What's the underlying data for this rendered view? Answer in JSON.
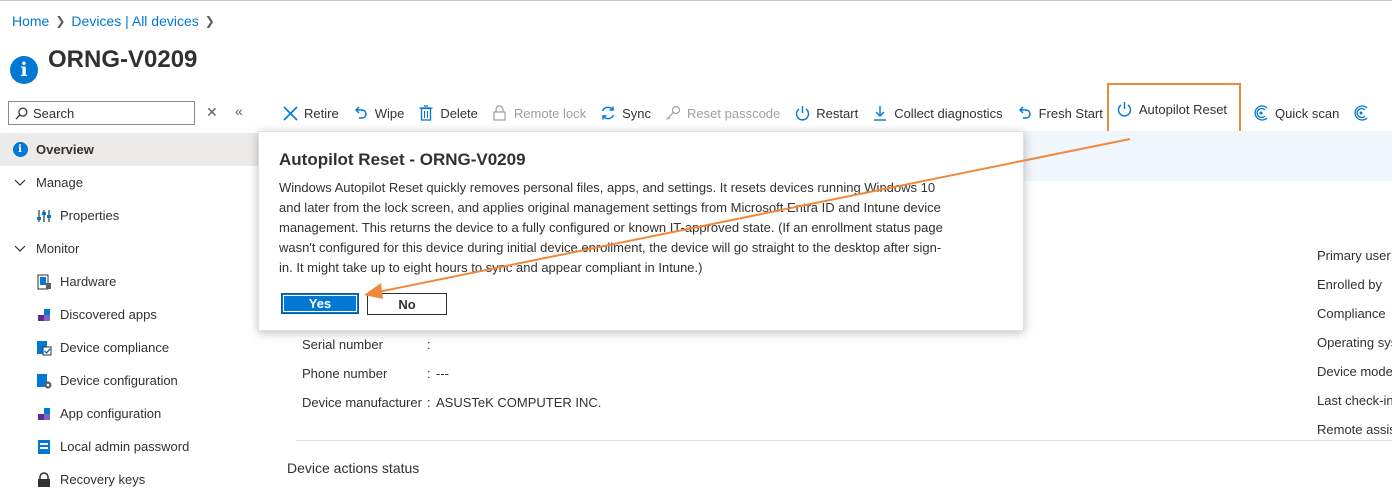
{
  "breadcrumb": {
    "home": "Home",
    "devices": "Devices | All devices"
  },
  "page": {
    "title": "ORNG-V0209"
  },
  "search": {
    "placeholder": "Search"
  },
  "sidebar": {
    "items": [
      {
        "label": "Overview",
        "icon": "info-icon",
        "active": true
      },
      {
        "label": "Manage",
        "icon": "chevron-down-icon"
      },
      {
        "label": "Properties",
        "icon": "sliders-icon"
      },
      {
        "label": "Monitor",
        "icon": "chevron-down-icon"
      },
      {
        "label": "Hardware",
        "icon": "hardware-icon"
      },
      {
        "label": "Discovered apps",
        "icon": "apps-icon"
      },
      {
        "label": "Device compliance",
        "icon": "compliance-icon"
      },
      {
        "label": "Device configuration",
        "icon": "configuration-icon"
      },
      {
        "label": "App configuration",
        "icon": "app-config-icon"
      },
      {
        "label": "Local admin password",
        "icon": "password-icon"
      },
      {
        "label": "Recovery keys",
        "icon": "key-icon"
      }
    ]
  },
  "toolbar": {
    "retire": "Retire",
    "wipe": "Wipe",
    "delete": "Delete",
    "remote_lock": "Remote lock",
    "sync": "Sync",
    "reset_passcode": "Reset passcode",
    "restart": "Restart",
    "collect_diagnostics": "Collect diagnostics",
    "fresh_start": "Fresh Start",
    "autopilot_reset": "Autopilot Reset",
    "quick_scan": "Quick scan"
  },
  "properties": [
    {
      "key": "Serial number",
      "value": ""
    },
    {
      "key": "Phone number",
      "value": "---"
    },
    {
      "key": "Device manufacturer",
      "value": "ASUSTeK COMPUTER INC."
    }
  ],
  "right_properties": [
    "Primary user",
    "Enrolled by",
    "Compliance",
    "Operating sys",
    "Device mode",
    "Last check-in",
    "Remote assis"
  ],
  "section": {
    "actions_status": "Device actions status"
  },
  "dialog": {
    "title": "Autopilot Reset - ORNG-V0209",
    "lines": [
      "Windows Autopilot Reset quickly removes personal files, apps, and settings. It resets devices running Windows 10",
      "and later from the lock screen, and applies original management settings from Microsoft Entra ID and Intune device",
      "management. This returns the device to a fully configured or known IT-approved state. (If an enrollment status page",
      "wasn't configured for this device during initial device enrollment, the device will go straight to the desktop after sign-",
      "in. It might take up to eight hours to sync and appear compliant in Intune.)"
    ],
    "yes": "Yes",
    "no": "No"
  },
  "colors": {
    "accent": "#0078d4",
    "annotation": "#f0883e"
  }
}
